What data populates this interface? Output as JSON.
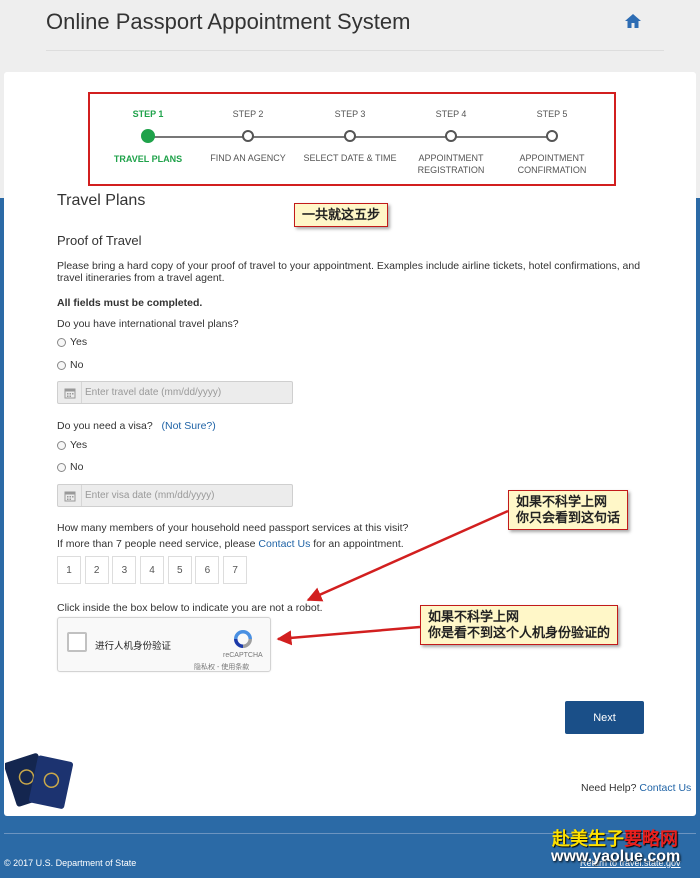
{
  "header": {
    "title": "Online Passport Appointment System",
    "home_icon": "home-icon"
  },
  "steps": [
    {
      "label": "STEP 1",
      "name": "TRAVEL PLANS",
      "active": true
    },
    {
      "label": "STEP 2",
      "name": "FIND AN AGENCY",
      "active": false
    },
    {
      "label": "STEP 3",
      "name": "SELECT DATE & TIME",
      "active": false
    },
    {
      "label": "STEP 4",
      "name": "APPOINTMENT REGISTRATION",
      "active": false
    },
    {
      "label": "STEP 5",
      "name": "APPOINTMENT CONFIRMATION",
      "active": false
    }
  ],
  "form": {
    "title": "Travel Plans",
    "section": "Proof of Travel",
    "intro": "Please bring a hard copy of your proof of travel to your appointment. Examples include airline tickets, hotel confirmations, and travel itineraries from a travel agent.",
    "required": "All fields must be completed.",
    "q_travel": "Do you have international travel plans?",
    "yes": "Yes",
    "no": "No",
    "travel_date_placeholder": "Enter travel date (mm/dd/yyyy)",
    "q_visa": "Do you need a visa?",
    "not_sure": "(Not Sure?)",
    "visa_date_placeholder": "Enter visa date (mm/dd/yyyy)",
    "q_household": "How many members of your household need passport services at this visit?",
    "more_than_pre": "If more than 7 people need service, please",
    "contact_us": "Contact Us",
    "more_than_post": "for an appointment.",
    "counts": [
      "1",
      "2",
      "3",
      "4",
      "5",
      "6",
      "7"
    ],
    "robot_prompt": "Click inside the box below to indicate you are not a robot.",
    "captcha_text": "进行人机身份验证",
    "captcha_brand": "reCAPTCHA",
    "captcha_terms": "隐私权 - 使用条款",
    "next": "Next"
  },
  "annotations": {
    "five_steps": "一共就这五步",
    "note1_line1": "如果不科学上网",
    "note1_line2": "你只会看到这句话",
    "note2_line1": "如果不科学上网",
    "note2_line2": "你是看不到这个人机身份验证的"
  },
  "footer": {
    "need_help": "Need Help?",
    "contact_us": "Contact Us",
    "copyright": "© 2017 U.S. Department of State",
    "return_link": "Return to travel.state.gov"
  },
  "watermark": {
    "line1_a": "赴美生子",
    "line1_b": "要略网",
    "line2": "www.yaolue.com"
  },
  "colors": {
    "accent_green": "#1fa24a",
    "primary_blue": "#1a4f88",
    "page_blue": "#2b6aa6",
    "annotation_red": "#d21f1f"
  }
}
